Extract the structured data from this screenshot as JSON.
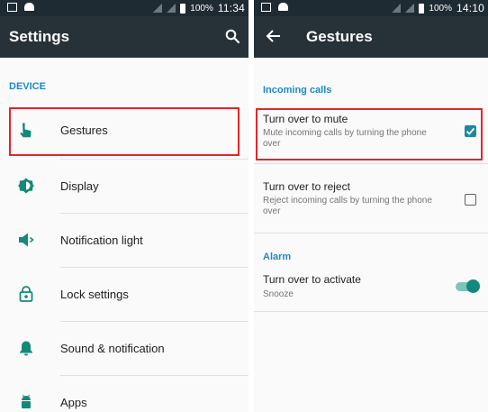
{
  "left": {
    "statusbar": {
      "battery": "100%",
      "time": "11:34"
    },
    "appbar": {
      "title": "Settings",
      "search_icon": "search-icon"
    },
    "section": "DEVICE",
    "items": [
      {
        "label": "Gestures",
        "icon": "gesture-hand-icon"
      },
      {
        "label": "Display",
        "icon": "brightness-icon"
      },
      {
        "label": "Notification light",
        "icon": "notification-light-icon"
      },
      {
        "label": "Lock settings",
        "icon": "lock-icon"
      },
      {
        "label": "Sound & notification",
        "icon": "bell-icon"
      },
      {
        "label": "Apps",
        "icon": "android-icon"
      }
    ]
  },
  "right": {
    "statusbar": {
      "battery": "100%",
      "time": "14:10"
    },
    "appbar": {
      "title": "Gestures",
      "back_icon": "back-arrow-icon"
    },
    "sections": {
      "incoming": "Incoming calls",
      "alarm": "Alarm"
    },
    "prefs": {
      "mute": {
        "title": "Turn over to mute",
        "summary": "Mute incoming calls by turning the phone over",
        "checked": true
      },
      "reject": {
        "title": "Turn over to reject",
        "summary": "Reject incoming calls by turning the phone over",
        "checked": false
      },
      "activate": {
        "title": "Turn over to activate",
        "summary": "Snooze",
        "enabled": true
      }
    }
  },
  "colors": {
    "accent": "#1e88c8",
    "appbar": "#263238",
    "statusbar": "#1f2b33",
    "highlight": "#e2272d",
    "toggle": "#14897a"
  }
}
